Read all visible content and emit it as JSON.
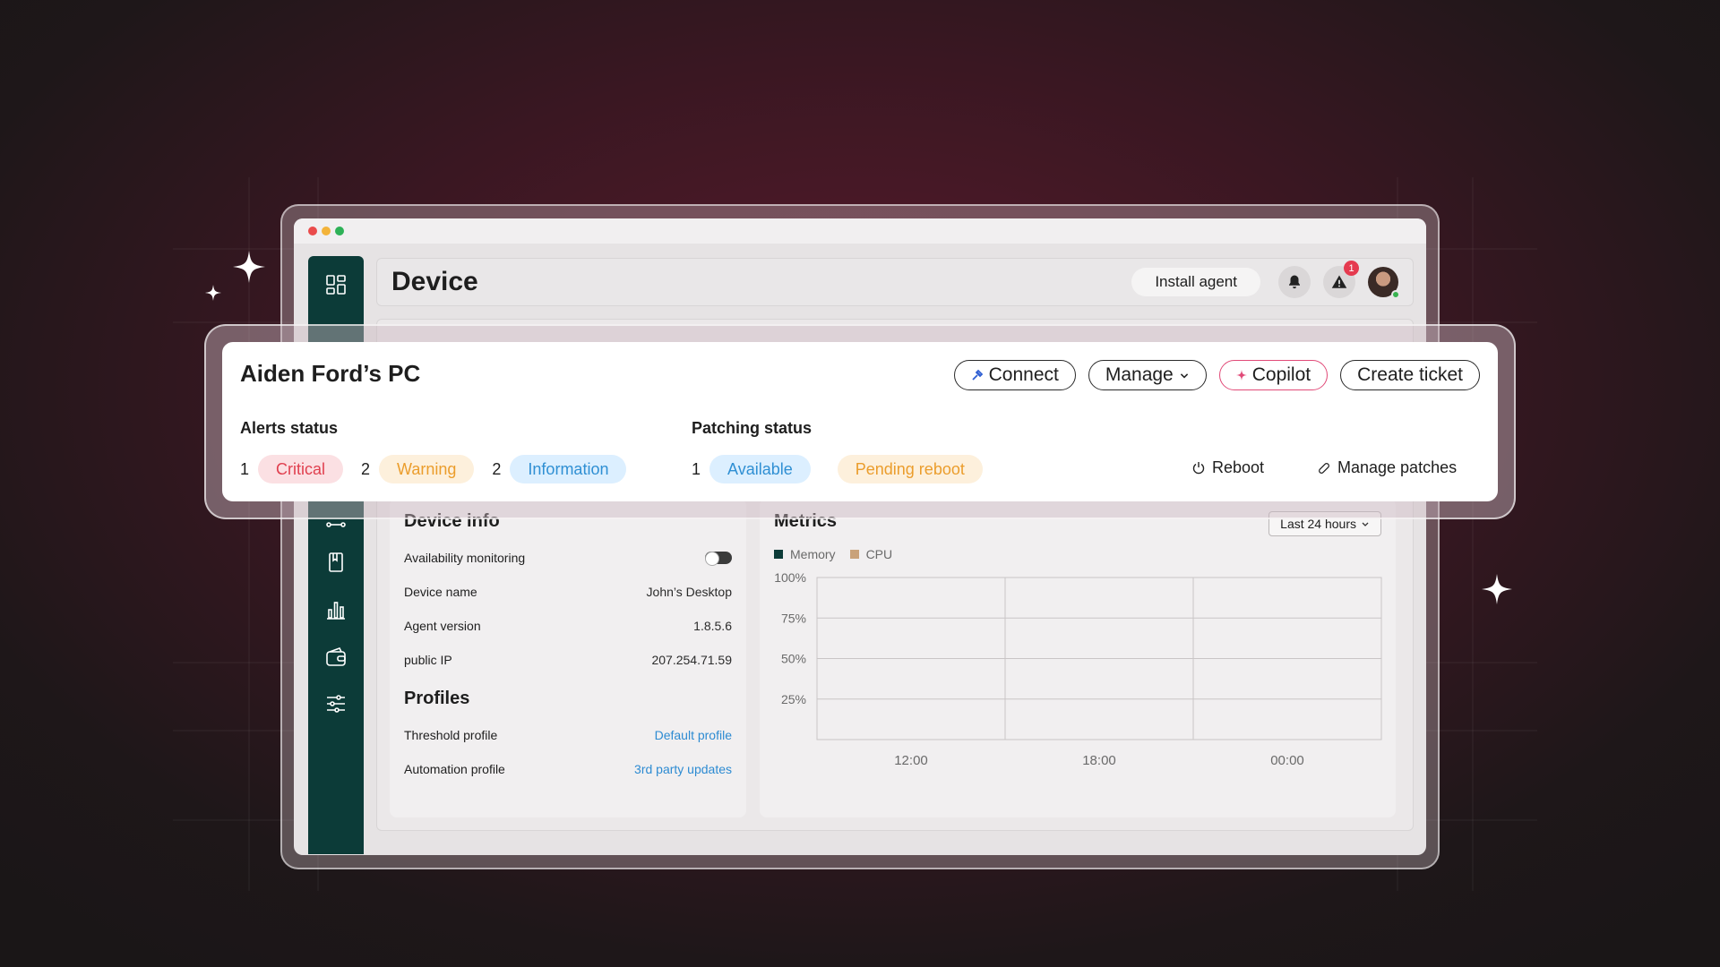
{
  "header": {
    "title": "Device",
    "install_label": "Install agent",
    "alert_badge_count": "1"
  },
  "device": {
    "name": "Aiden Ford’s PC",
    "actions": {
      "connect": "Connect",
      "manage": "Manage",
      "copilot": "Copilot",
      "create_ticket": "Create ticket"
    },
    "alerts": {
      "title": "Alerts status",
      "critical": {
        "count": "1",
        "label": "Critical"
      },
      "warning": {
        "count": "2",
        "label": "Warning"
      },
      "information": {
        "count": "2",
        "label": "Information"
      }
    },
    "patching": {
      "title": "Patching status",
      "available": {
        "count": "1",
        "label": "Available"
      },
      "pending_label": "Pending reboot",
      "reboot_label": "Reboot",
      "manage_patches_label": "Manage patches"
    }
  },
  "device_info": {
    "title": "Device info",
    "availability_label": "Availability monitoring",
    "rows": [
      {
        "label": "Device name",
        "value": "John’s Desktop"
      },
      {
        "label": "Agent version",
        "value": "1.8.5.6"
      },
      {
        "label": "public IP",
        "value": "207.254.71.59"
      }
    ]
  },
  "profiles": {
    "title": "Profiles",
    "rows": [
      {
        "label": "Threshold profile",
        "value": "Default profile"
      },
      {
        "label": "Automation profile",
        "value": "3rd party updates"
      }
    ]
  },
  "metrics": {
    "title": "Metrics",
    "range_label": "Last 24 hours",
    "legend": [
      {
        "name": "Memory",
        "color": "#0c3b38"
      },
      {
        "name": "CPU",
        "color": "#c9a27a"
      }
    ],
    "y_ticks": [
      "100%",
      "75%",
      "50%",
      "25%"
    ],
    "x_ticks": [
      "12:00",
      "18:00",
      "00:00"
    ]
  },
  "chart_data": {
    "type": "line",
    "title": "Metrics",
    "series": [
      {
        "name": "Memory",
        "values": []
      },
      {
        "name": "CPU",
        "values": []
      }
    ],
    "categories": [
      "12:00",
      "18:00",
      "00:00"
    ],
    "ylim": [
      0,
      100
    ],
    "yticks": [
      "100%",
      "75%",
      "50%",
      "25%"
    ],
    "grid": true,
    "legend": "top-left"
  },
  "colors": {
    "sidebar": "#0c3b38",
    "accent_blue": "#2f8fd3",
    "critical": "#e0404f",
    "warning": "#eb9d2c",
    "copilot": "#e14a78"
  },
  "sidebar_icons": [
    "dashboard-icon",
    "network-icon",
    "book-icon",
    "bar-chart-icon",
    "wallet-icon",
    "sliders-icon"
  ]
}
